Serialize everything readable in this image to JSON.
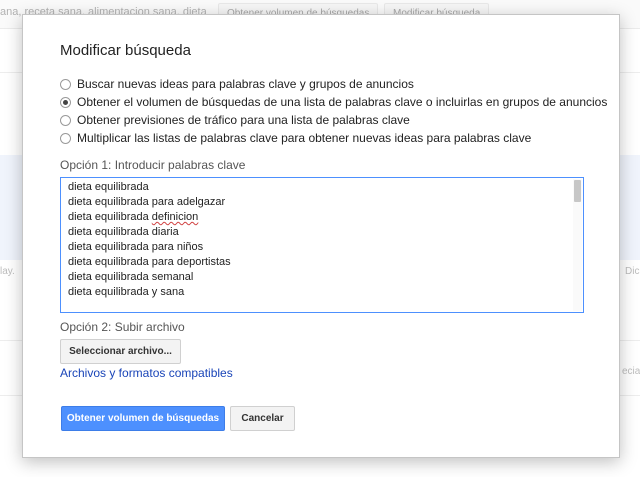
{
  "background": {
    "breadcrumb": "ana, receta sana, alimentacion sana, dieta",
    "tabs": [
      "Obtener volumen de búsquedas",
      "Modificar búsqueda"
    ],
    "left_fragment": "lay.",
    "right_fragment": "Dic",
    "right_fragment_2": "ecia"
  },
  "dialog": {
    "title": "Modificar búsqueda",
    "options": [
      {
        "label": "Buscar nuevas ideas para palabras clave y grupos de anuncios",
        "checked": false
      },
      {
        "label": "Obtener el volumen de búsquedas de una lista de palabras clave o incluirlas en grupos de anuncios",
        "checked": true
      },
      {
        "label": "Obtener previsiones de tráfico para una lista de palabras clave",
        "checked": false
      },
      {
        "label": "Multiplicar las listas de palabras clave para obtener nuevas ideas para palabras clave",
        "checked": false
      }
    ],
    "option1_label": "Opción 1: Introducir palabras clave",
    "keywords": [
      "dieta equilibrada",
      "dieta equilibrada para adelgazar",
      "dieta equilibrada",
      "definicion",
      "dieta equilibrada diaria",
      "dieta equilibrada para niños",
      "dieta equilibrada para deportistas",
      "dieta equilibrada semanal",
      "dieta equilibrada y sana"
    ],
    "option2_label": "Opción 2: Subir archivo",
    "select_file_button": "Seleccionar archivo...",
    "compatible_link": "Archivos y formatos compatibles",
    "submit_button": "Obtener volumen de búsquedas",
    "cancel_button": "Cancelar"
  },
  "colors": {
    "accent": "#4d90fe",
    "link": "#1a45b8"
  }
}
